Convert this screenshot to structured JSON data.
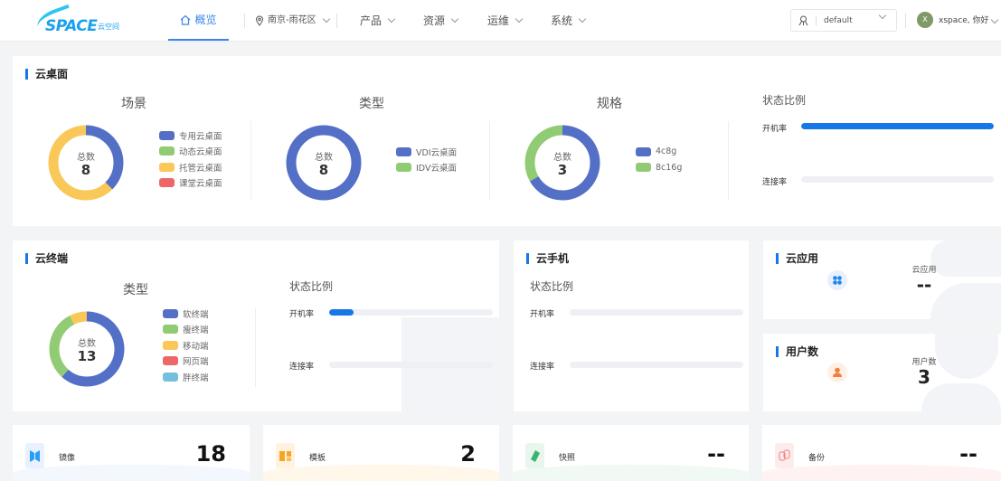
{
  "nav": {
    "logo": "SPACE",
    "logo_sub": "云空间",
    "overview": "概览",
    "location": "南京-雨花区",
    "items": [
      "产品",
      "资源",
      "运维",
      "系统"
    ],
    "tenant": "default",
    "user_initial": "X",
    "user": "xspace, 你好"
  },
  "desktop": {
    "title": "云桌面",
    "center_label": "总数",
    "scene": {
      "title": "场景",
      "total": "8",
      "items": [
        {
          "label": "专用云桌面",
          "value": 3,
          "color": "#5470c6"
        },
        {
          "label": "动态云桌面",
          "value": 0,
          "color": "#91cc75"
        },
        {
          "label": "托管云桌面",
          "value": 5,
          "color": "#fac858"
        },
        {
          "label": "课堂云桌面",
          "value": 0,
          "color": "#ee6666"
        }
      ]
    },
    "type": {
      "title": "类型",
      "total": "8",
      "items": [
        {
          "label": "VDI云桌面",
          "value": 8,
          "color": "#5470c6"
        },
        {
          "label": "IDV云桌面",
          "value": 0,
          "color": "#91cc75"
        }
      ]
    },
    "spec": {
      "title": "规格",
      "total": "3",
      "items": [
        {
          "label": "4c8g",
          "value": 2,
          "color": "#5470c6"
        },
        {
          "label": "8c16g",
          "value": 1,
          "color": "#91cc75"
        }
      ]
    },
    "status": {
      "title": "状态比例",
      "power_label": "开机率",
      "power": 100,
      "connect_label": "连接率",
      "connect": 0
    }
  },
  "terminal": {
    "title": "云终端",
    "center_label": "总数",
    "type": {
      "title": "类型",
      "total": "13",
      "items": [
        {
          "label": "软终端",
          "value": 8,
          "color": "#5470c6"
        },
        {
          "label": "瘦终端",
          "value": 4,
          "color": "#91cc75"
        },
        {
          "label": "移动端",
          "value": 1,
          "color": "#fac858"
        },
        {
          "label": "网页端",
          "value": 0,
          "color": "#ee6666"
        },
        {
          "label": "胖终端",
          "value": 0,
          "color": "#73c0de"
        }
      ]
    },
    "status": {
      "title": "状态比例",
      "power_label": "开机率",
      "power": 15,
      "connect_label": "连接率",
      "connect": 0
    }
  },
  "phone": {
    "title": "云手机",
    "status": {
      "title": "状态比例",
      "power_label": "开机率",
      "power": 0,
      "connect_label": "连接率",
      "connect": 0
    }
  },
  "app": {
    "title": "云应用",
    "label": "云应用",
    "value": "--"
  },
  "users": {
    "title": "用户数",
    "label": "用户数",
    "value": "3"
  },
  "bottom": [
    {
      "label": "镜像",
      "value": "18",
      "color": "#2a9df4",
      "bg": "#e8f1fd"
    },
    {
      "label": "模板",
      "value": "2",
      "color": "#f5a623",
      "bg": "#fff3e0"
    },
    {
      "label": "快照",
      "value": "--",
      "color": "#3cb371",
      "bg": "#e8f6ee"
    },
    {
      "label": "备份",
      "value": "--",
      "color": "#f08080",
      "bg": "#fdecec"
    }
  ]
}
